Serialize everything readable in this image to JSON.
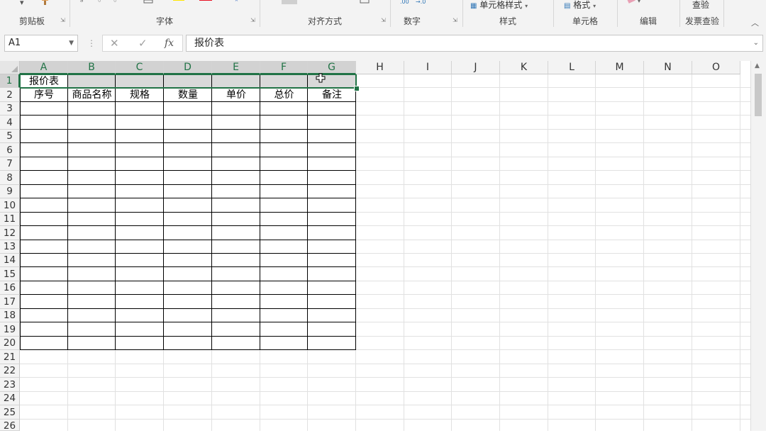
{
  "ribbon": {
    "groups": {
      "clipboard": "剪贴板",
      "font": "字体",
      "alignment": "对齐方式",
      "number": "数字",
      "styles": "样式",
      "cells": "单元格",
      "editing": "编辑",
      "invoice": "发票查验"
    },
    "cell_styles_label": "单元格样式",
    "format_label": "格式",
    "invoice_check_label": "查验",
    "colors": {
      "highlight": "#ffe600",
      "font_color": "#e81123"
    }
  },
  "formula_bar": {
    "name_box": "A1",
    "cancel": "✕",
    "enter": "✓",
    "fx": "fx",
    "content": "报价表"
  },
  "columns": [
    "A",
    "B",
    "C",
    "D",
    "E",
    "F",
    "G",
    "H",
    "I",
    "J",
    "K",
    "L",
    "M",
    "N",
    "O"
  ],
  "rows": [
    "1",
    "2",
    "3",
    "4",
    "5",
    "6",
    "7",
    "8",
    "9",
    "10",
    "11",
    "12",
    "13",
    "14",
    "15",
    "16",
    "17",
    "18",
    "19",
    "20",
    "21",
    "22",
    "23",
    "24",
    "25",
    "26"
  ],
  "sheet": {
    "title_cell": "报价表",
    "headers": [
      "序号",
      "商品名称",
      "规格",
      "数量",
      "单价",
      "总价",
      "备注"
    ]
  },
  "colors": {
    "accent": "#217346",
    "selection_fill": "#d9d9d9",
    "ribbon_bg": "#f3f3f3"
  }
}
